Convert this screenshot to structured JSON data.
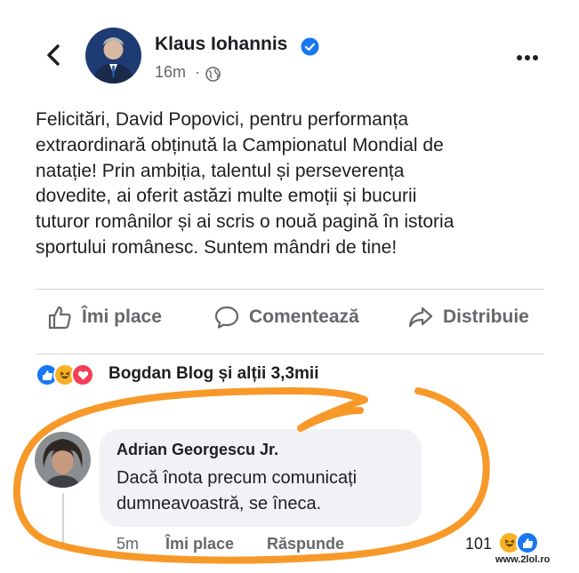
{
  "header": {
    "author": "Klaus Iohannis",
    "timestamp": "16m",
    "separator": "·"
  },
  "post": {
    "lines": [
      "Felicitări, David Popovici, pentru performanța",
      "extraordinară obținută la Campionatul Mondial de",
      "natație! Prin ambiția, talentul și perseverența",
      "dovedite, ai oferit astăzi multe emoții și bucurii",
      "tuturor românilor și ai scris o nouă pagină în istoria",
      "sportului românesc. Suntem mândri de tine!"
    ]
  },
  "actions": {
    "like": "Îmi place",
    "comment": "Comentează",
    "share": "Distribuie"
  },
  "reactions": {
    "summary": "Bogdan Blog și alții 3,3mii",
    "icons": [
      "like-reaction",
      "haha-reaction",
      "love-reaction"
    ]
  },
  "comment": {
    "author": "Adrian Georgescu Jr.",
    "lines": [
      "Dacă înota precum comunicați",
      "dumneavoastră, se îneca."
    ],
    "time": "5m",
    "like": "Îmi place",
    "reply": "Răspunde",
    "reaction_count": "101"
  },
  "watermark": "www.2lol.ro",
  "colors": {
    "brand_blue": "#1877f2",
    "text": "#1c1e21",
    "muted": "#65676b",
    "bubble": "#f0f2f5",
    "scribble": "#f7931e"
  }
}
